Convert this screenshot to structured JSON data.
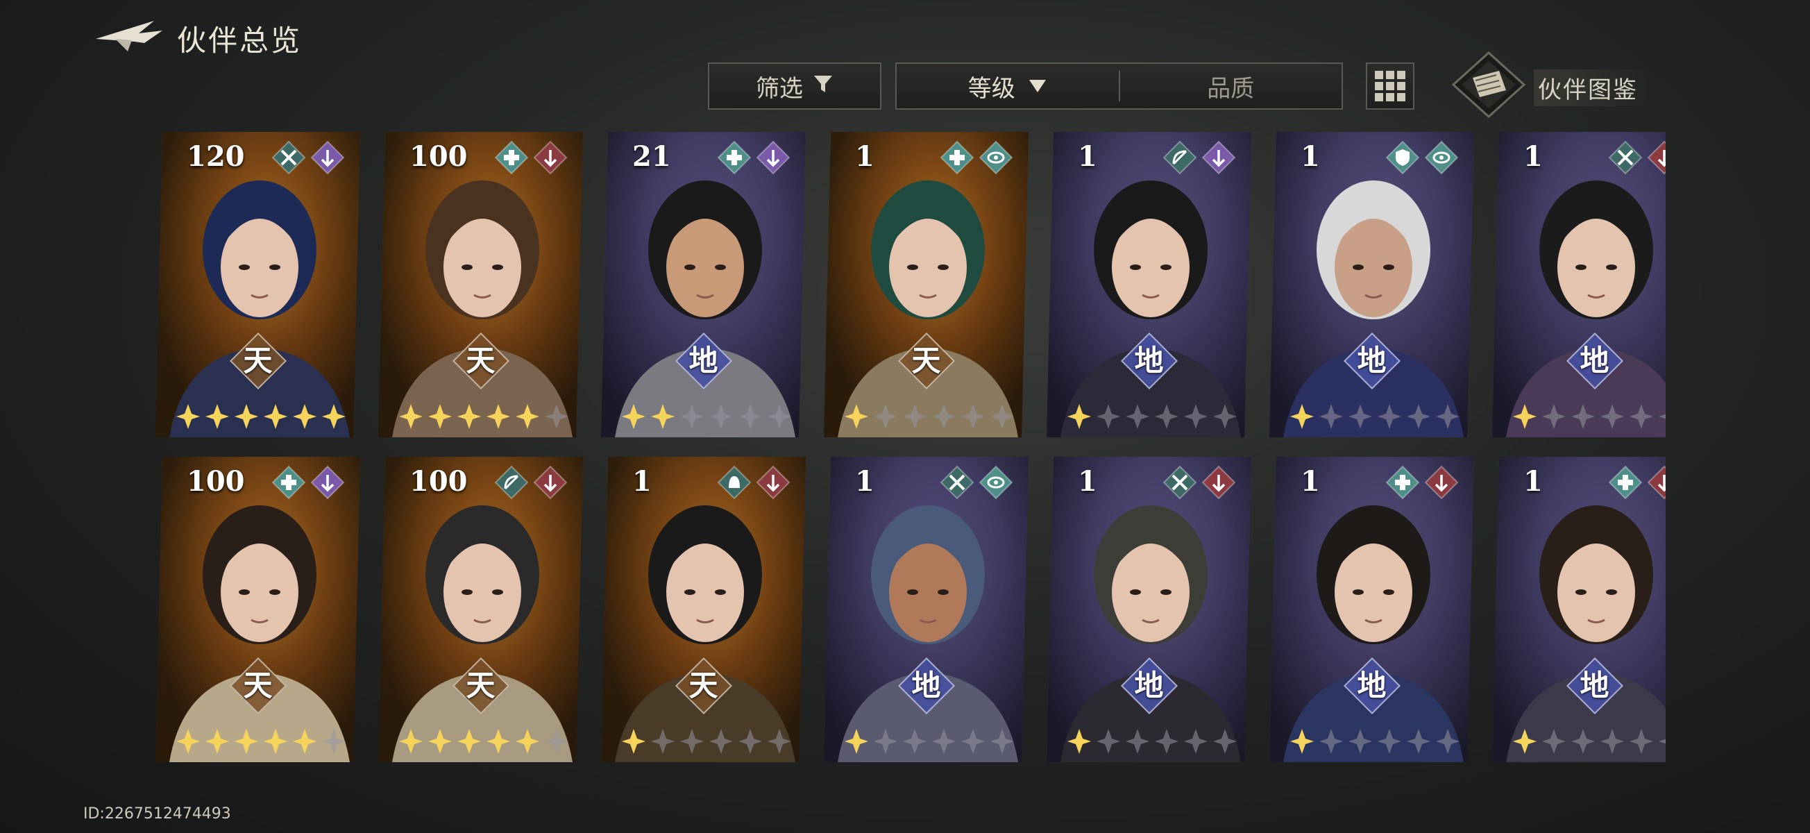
{
  "header": {
    "title": "伙伴总览",
    "back_icon": "back-arrow-icon"
  },
  "toolbar": {
    "filter_label": "筛选",
    "sort_level_label": "等级",
    "sort_quality_label": "品质",
    "grid_icon": "grid-icon",
    "codex_label": "伙伴图鉴"
  },
  "footer": {
    "user_id": "ID:2267512474493"
  },
  "colors": {
    "tian_grade": "#b07830",
    "di_grade": "#4a55b0",
    "star_lit": "#f6d35a",
    "star_dim": "#8b8b95",
    "tag_teal": "#4f8f8a",
    "tag_purple": "#7a5aa8",
    "tag_red": "#8a3a40"
  },
  "partners": [
    {
      "level": "120",
      "grade": "天",
      "stars": 6,
      "tags": [
        "swords-icon",
        "purple-hook-icon"
      ],
      "portrait": "hooded-man"
    },
    {
      "level": "100",
      "grade": "天",
      "stars": 5,
      "tags": [
        "teal-cross-icon",
        "red-hook-icon"
      ],
      "portrait": "suit-man"
    },
    {
      "level": "21",
      "grade": "地",
      "stars": 2,
      "tags": [
        "teal-cross-icon",
        "purple-hook-icon"
      ],
      "portrait": "stout-man"
    },
    {
      "level": "1",
      "grade": "天",
      "stars": 1,
      "tags": [
        "teal-medic-icon",
        "teal-eye-icon"
      ],
      "portrait": "green-hair-woman"
    },
    {
      "level": "1",
      "grade": "地",
      "stars": 1,
      "tags": [
        "bow-icon",
        "purple-hook-icon"
      ],
      "portrait": "short-hair-woman"
    },
    {
      "level": "1",
      "grade": "地",
      "stars": 1,
      "tags": [
        "teal-shield-icon",
        "teal-eye-icon"
      ],
      "portrait": "old-man"
    },
    {
      "level": "1",
      "grade": "地",
      "stars": 1,
      "tags": [
        "swords-icon",
        "red-hook-icon"
      ],
      "portrait": "ponytail-woman"
    },
    {
      "level": "100",
      "grade": "天",
      "stars": 5,
      "tags": [
        "teal-medic-icon",
        "purple-hook-icon"
      ],
      "portrait": "bun-girl"
    },
    {
      "level": "100",
      "grade": "天",
      "stars": 5,
      "tags": [
        "bow-icon",
        "red-hook-icon"
      ],
      "portrait": "bob-woman"
    },
    {
      "level": "1",
      "grade": "天",
      "stars": 1,
      "tags": [
        "bell-icon",
        "red-hook-icon"
      ],
      "portrait": "young-boy"
    },
    {
      "level": "1",
      "grade": "地",
      "stars": 1,
      "tags": [
        "swords-icon",
        "teal-eye-icon"
      ],
      "portrait": "turban-elder"
    },
    {
      "level": "1",
      "grade": "地",
      "stars": 1,
      "tags": [
        "swords-icon",
        "red-hook-icon"
      ],
      "portrait": "beanie-man"
    },
    {
      "level": "1",
      "grade": "地",
      "stars": 1,
      "tags": [
        "teal-medic-icon",
        "red-hook-icon"
      ],
      "portrait": "camera-youth"
    },
    {
      "level": "1",
      "grade": "地",
      "stars": 1,
      "tags": [
        "teal-medic-icon",
        "red-hook-icon"
      ],
      "portrait": "earring-woman"
    }
  ]
}
